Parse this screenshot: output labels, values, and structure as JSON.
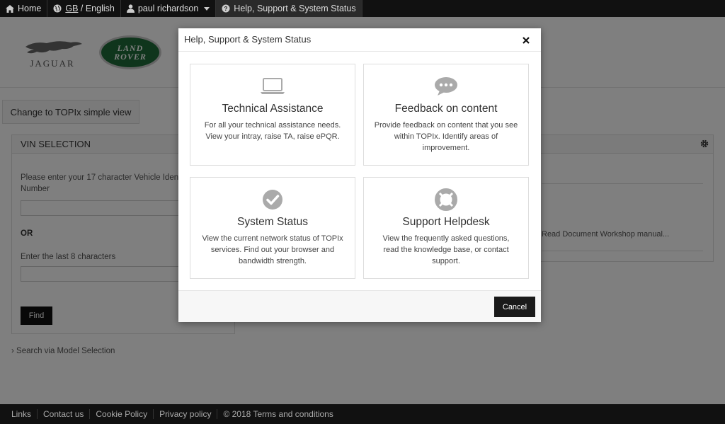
{
  "topnav": {
    "home": "Home",
    "region_code": "GB",
    "region_sep": " / ",
    "language": "English",
    "user": "paul richardson",
    "help": "Help, Support & System Status"
  },
  "brand": {
    "jaguar": "JAGUAR",
    "land_rover_line1": "LAND",
    "land_rover_line2": "ROVER"
  },
  "page": {
    "simple_view_button": "Change to TOPIx simple view",
    "vin_panel": {
      "title": "VIN SELECTION",
      "label_full": "Please enter your 17 character Vehicle Identification Number",
      "or": "OR",
      "label_last8": "Enter the last 8 characters",
      "find_button": "Find"
    },
    "model_link": "› Search via Model Selection",
    "right_panel_doc": "Read Document Workshop manual..."
  },
  "modal": {
    "title": "Help, Support & System Status",
    "tiles": [
      {
        "icon": "laptop-icon",
        "title": "Technical Assistance",
        "desc": "For all your technical assistance needs. View your intray, raise TA, raise ePQR."
      },
      {
        "icon": "chat-bubble-icon",
        "title": "Feedback on content",
        "desc": "Provide feedback on content that you see within TOPIx. Identify areas of improvement."
      },
      {
        "icon": "check-circle-icon",
        "title": "System Status",
        "desc": "View the current network status of TOPIx services. Find out your browser and bandwidth strength."
      },
      {
        "icon": "lifebuoy-icon",
        "title": "Support Helpdesk",
        "desc": "View the frequently asked questions, read the knowledge base, or contact support."
      }
    ],
    "cancel": "Cancel"
  },
  "footer": {
    "links": [
      "Links",
      "Contact us",
      "Cookie Policy",
      "Privacy policy",
      "© 2018 Terms and conditions"
    ]
  },
  "colors": {
    "nav_bg": "#111111",
    "overlay": "rgba(0,0,0,0.5)",
    "icon_gray": "#aaaaaa",
    "land_rover_green": "#1e6a38",
    "primary_button": "#1a1a1a"
  }
}
